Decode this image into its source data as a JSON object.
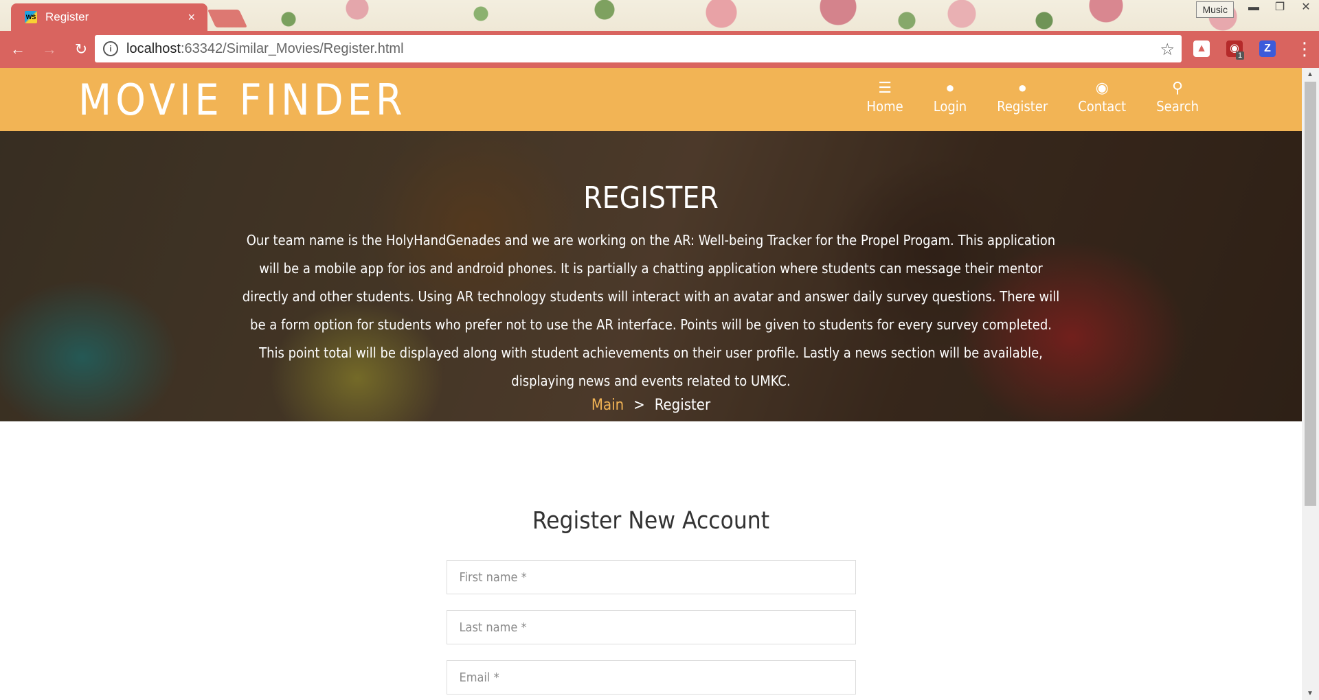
{
  "browser": {
    "tab_title": "Register",
    "tab_close": "×",
    "music_button": "Music",
    "url_host": "localhost",
    "url_rest": ":63342/Similar_Movies/Register.html",
    "ext_badge": "1"
  },
  "site": {
    "logo": "MOVIE FINDER",
    "nav": [
      {
        "label": "Home",
        "icon": "list-icon"
      },
      {
        "label": "Login",
        "icon": "user-icon"
      },
      {
        "label": "Register",
        "icon": "user-icon"
      },
      {
        "label": "Contact",
        "icon": "globe-icon"
      },
      {
        "label": "Search",
        "icon": "search-icon"
      }
    ]
  },
  "hero": {
    "title": "REGISTER",
    "text": "Our team name is the HolyHandGenades and we are working on the AR: Well-being Tracker for the Propel Progam. This application will be a mobile app for ios and android phones. It is partially a chatting application where students can message their mentor directly and other students. Using AR technology students will interact with an avatar and answer daily survey questions. There will be a form option for students who prefer not to use the AR interface. Points will be given to students for every survey completed. This point total will be displayed along with student achievements on their user profile. Lastly a news section will be available, displaying news and events related to UMKC.",
    "breadcrumb": {
      "link": "Main",
      "separator": ">",
      "current": "Register"
    }
  },
  "form": {
    "title": "Register New Account",
    "first_name_placeholder": "First name *",
    "last_name_placeholder": "Last name *",
    "email_placeholder": "Email *"
  }
}
